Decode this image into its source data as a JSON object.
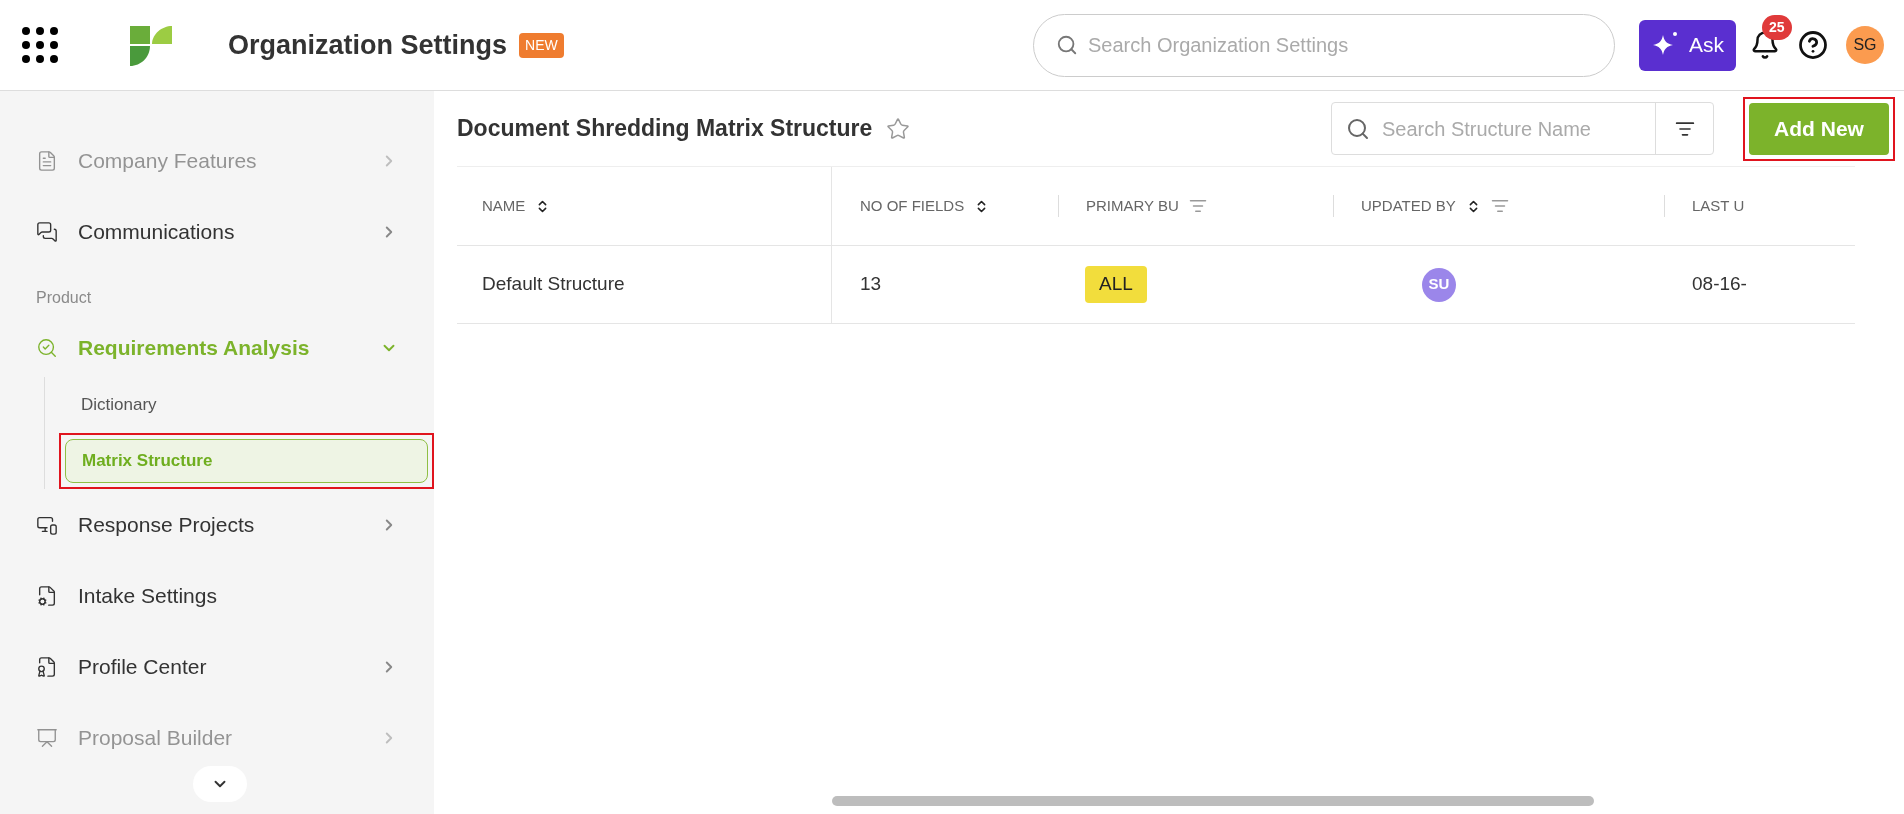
{
  "header": {
    "title": "Organization Settings",
    "badge": "NEW",
    "search": {
      "placeholder": "Search Organization Settings"
    },
    "ask_button": "Ask",
    "notifications": "25",
    "avatar": "SG"
  },
  "sidebar": {
    "items": [
      {
        "kind": "item",
        "label": "Company Features",
        "expandable": true,
        "expanded": false,
        "selected": false,
        "faded": true
      },
      {
        "kind": "item",
        "label": "Communications",
        "expandable": true,
        "expanded": false,
        "selected": false,
        "faded": false
      },
      {
        "kind": "heading",
        "label": "Product"
      },
      {
        "kind": "item",
        "label": "Requirements Analysis",
        "expandable": true,
        "expanded": true,
        "selected": true,
        "faded": false,
        "children": [
          {
            "label": "Dictionary",
            "selected": false,
            "highlighted": false
          },
          {
            "label": "Matrix Structure",
            "selected": true,
            "highlighted": true
          }
        ]
      },
      {
        "kind": "item",
        "label": "Response Projects",
        "expandable": true,
        "expanded": false,
        "selected": false,
        "faded": false
      },
      {
        "kind": "item",
        "label": "Intake Settings",
        "expandable": false,
        "selected": false,
        "faded": false
      },
      {
        "kind": "item",
        "label": "Profile Center",
        "expandable": true,
        "expanded": false,
        "selected": false,
        "faded": false
      },
      {
        "kind": "item",
        "label": "Proposal Builder",
        "expandable": true,
        "expanded": false,
        "selected": false,
        "faded": true
      }
    ]
  },
  "page": {
    "title": "Document Shredding Matrix Structure",
    "starred": false,
    "search": {
      "placeholder": "Search Structure Name"
    },
    "add_button": "Add New",
    "add_highlighted": true
  },
  "table": {
    "columns": [
      {
        "label": "NAME",
        "sortable": true,
        "filterable": false
      },
      {
        "label": "NO OF FIELDS",
        "sortable": true,
        "filterable": false
      },
      {
        "label": "PRIMARY BU",
        "sortable": false,
        "filterable": true
      },
      {
        "label": "UPDATED BY",
        "sortable": true,
        "filterable": true
      },
      {
        "label": "LAST U",
        "sortable": false,
        "filterable": false
      }
    ],
    "rows": [
      {
        "name": "Default Structure",
        "fields": "13",
        "primary_bu": "ALL",
        "updated_by": "SU",
        "last": "08-16-"
      }
    ]
  }
}
